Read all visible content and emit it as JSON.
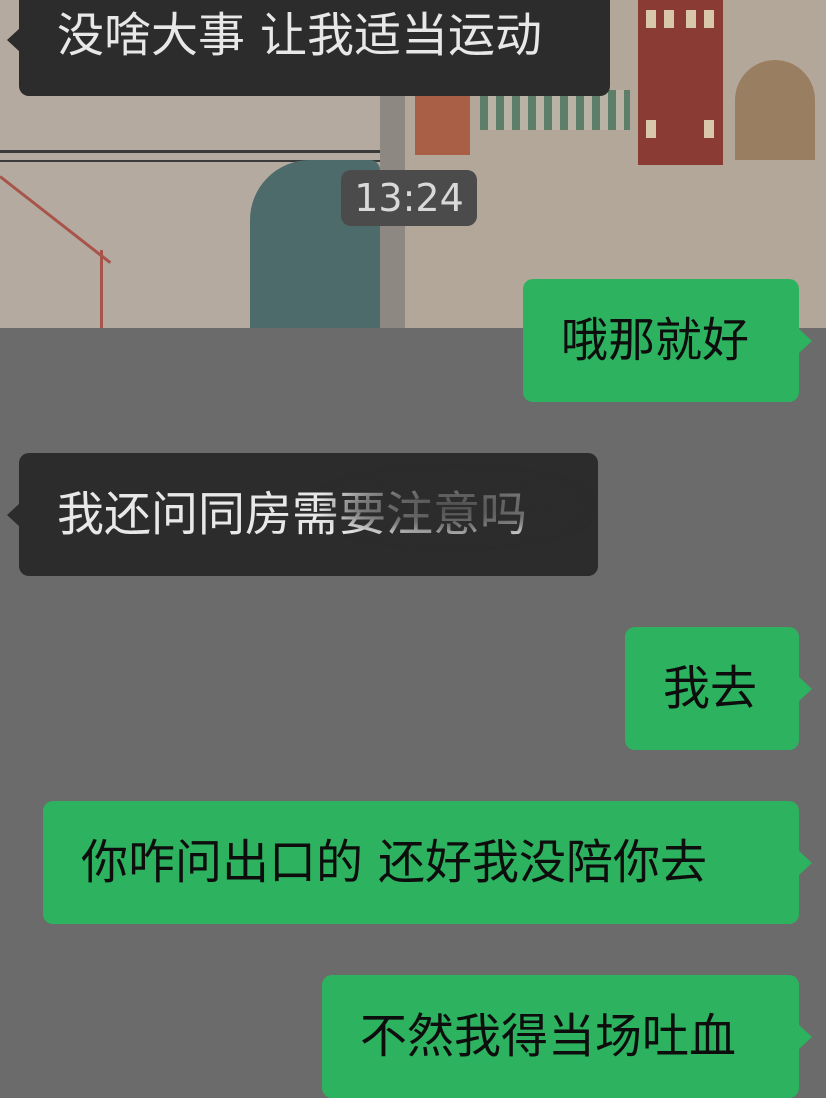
{
  "chat": {
    "timestamp": "13:24",
    "messages": [
      {
        "side": "left",
        "text": "没啥大事 让我适当运动"
      },
      {
        "side": "right",
        "text": "哦那就好"
      },
      {
        "side": "left",
        "text": "我还问同房需要注意吗"
      },
      {
        "side": "right",
        "text": "我去"
      },
      {
        "side": "right",
        "text": "你咋问出口的 还好我没陪你去"
      },
      {
        "side": "right",
        "text": "不然我得当场吐血"
      }
    ]
  },
  "colors": {
    "background": "#6b6b6b",
    "incoming_bubble": "#2c2c2c",
    "outgoing_bubble": "#2db25f",
    "timestamp_bg": "#4b4b4b"
  }
}
